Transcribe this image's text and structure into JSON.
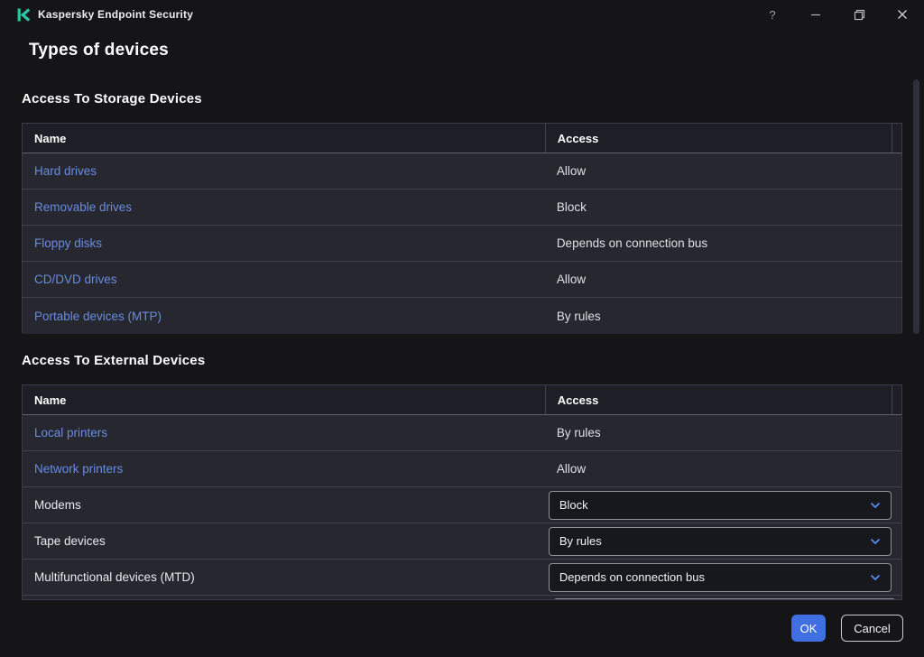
{
  "window": {
    "title": "Kaspersky Endpoint Security",
    "help_label": "?"
  },
  "page": {
    "title": "Types of devices"
  },
  "sections": [
    {
      "title": "Access To Storage Devices",
      "columns": {
        "name": "Name",
        "access": "Access"
      },
      "rows": [
        {
          "name": "Hard drives",
          "access": "Allow"
        },
        {
          "name": "Removable drives",
          "access": "Block"
        },
        {
          "name": "Floppy disks",
          "access": "Depends on connection bus"
        },
        {
          "name": "CD/DVD drives",
          "access": "Allow"
        },
        {
          "name": "Portable devices (MTP)",
          "access": "By rules"
        }
      ]
    },
    {
      "title": "Access To External Devices",
      "columns": {
        "name": "Name",
        "access": "Access"
      },
      "rows": [
        {
          "name": "Local printers",
          "access": "By rules"
        },
        {
          "name": "Network printers",
          "access": "Allow"
        },
        {
          "name": "Modems",
          "access": "Block"
        },
        {
          "name": "Tape devices",
          "access": "By rules"
        },
        {
          "name": "Multifunctional devices (MTD)",
          "access": "Depends on connection bus"
        }
      ]
    }
  ],
  "footer": {
    "ok": "OK",
    "cancel": "Cancel"
  },
  "colors": {
    "brand_teal": "#2bc4a4",
    "link_blue": "#698ce0",
    "button_blue": "#3f6fe3",
    "chevron_blue": "#5a8cf0"
  }
}
